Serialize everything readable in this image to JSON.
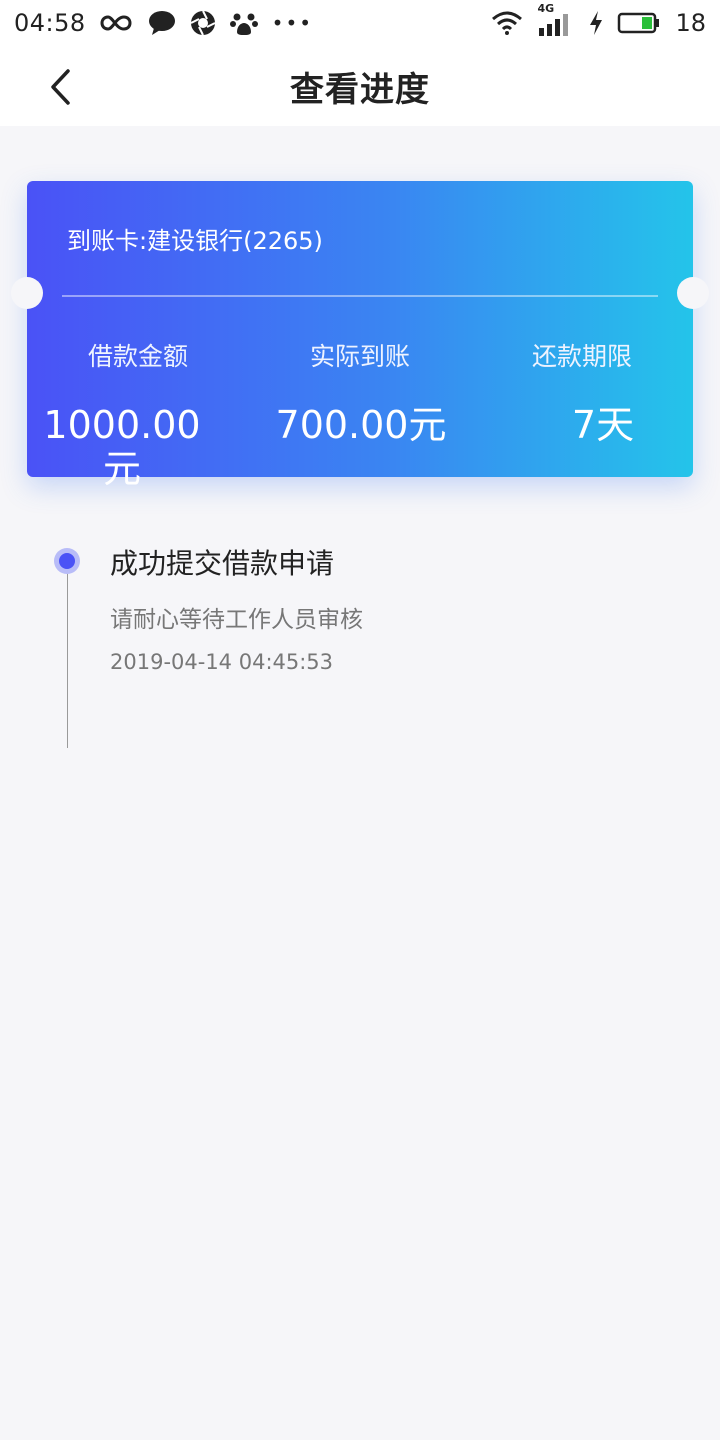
{
  "status_bar": {
    "time": "04:58",
    "battery_level": "18",
    "network_label": "4G",
    "icons": [
      "infinity-icon",
      "chat-bubble-icon",
      "aperture-icon",
      "paw-icon",
      "more-dots-icon",
      "wifi-icon",
      "signal-icon",
      "charging-icon",
      "battery-icon"
    ]
  },
  "header": {
    "title": "查看进度",
    "back_icon": "chevron-left-icon"
  },
  "card": {
    "account": "到账卡:建设银行(2265)",
    "columns": [
      {
        "label": "借款金额",
        "value": "1000.00元"
      },
      {
        "label": "实际到账",
        "value": "700.00元"
      },
      {
        "label": "还款期限",
        "value": "7天"
      }
    ],
    "gradient_start": "#4a52f6",
    "gradient_end": "#24c4ea"
  },
  "timeline": {
    "items": [
      {
        "title": "成功提交借款申请",
        "description": "请耐心等待工作人员审核",
        "timestamp": "2019-04-14 04:45:53"
      }
    ],
    "accent_color": "#4a52f6"
  }
}
